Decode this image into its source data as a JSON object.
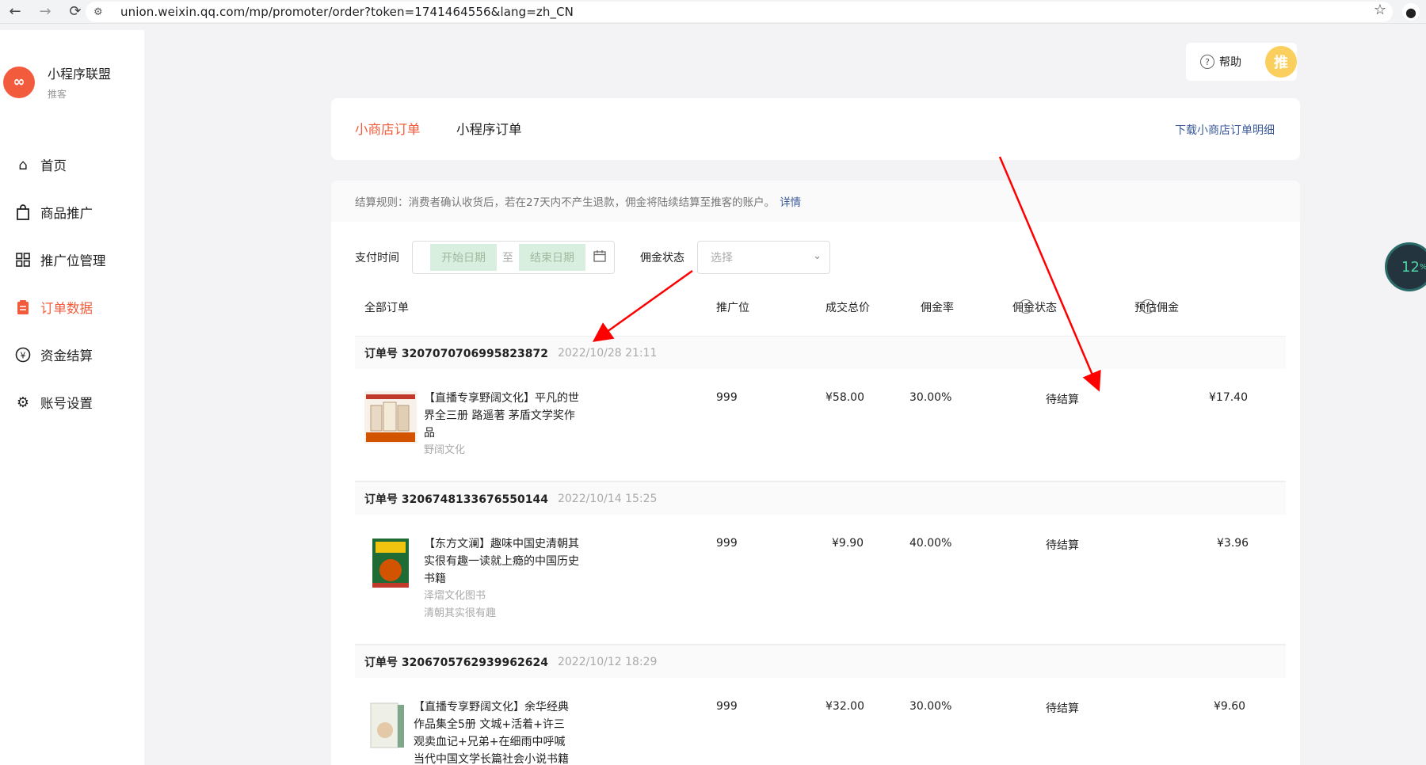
{
  "browser": {
    "url": "union.weixin.qq.com/mp/promoter/order?token=1741464556&lang=zh_CN"
  },
  "sidebar": {
    "brand_name": "小程序联盟",
    "brand_role": "推客",
    "items": [
      {
        "label": "首页",
        "icon": "home-icon"
      },
      {
        "label": "商品推广",
        "icon": "shopping-bag-icon"
      },
      {
        "label": "推广位管理",
        "icon": "grid-icon"
      },
      {
        "label": "订单数据",
        "icon": "clipboard-icon",
        "active": true
      },
      {
        "label": "资金结算",
        "icon": "yuan-coin-icon"
      },
      {
        "label": "账号设置",
        "icon": "gear-icon"
      }
    ]
  },
  "header": {
    "help_label": "帮助",
    "avatar_text": "推"
  },
  "tabs": {
    "shop_orders": "小商店订单",
    "mini_orders": "小程序订单",
    "download": "下载小商店订单明细"
  },
  "rule": {
    "text": "结算规则：消费者确认收货后，若在27天内不产生退款，佣金将陆续结算至推客的账户。",
    "detail": "详情"
  },
  "filters": {
    "pay_time_label": "支付时间",
    "start_placeholder": "开始日期",
    "separator": "至",
    "end_placeholder": "结束日期",
    "commission_status_label": "佣金状态",
    "select_placeholder": "选择"
  },
  "table": {
    "headers": {
      "all_orders": "全部订单",
      "position": "推广位",
      "total": "成交总价",
      "rate": "佣金率",
      "status": "佣金状态",
      "estimate": "预估佣金"
    }
  },
  "orders": [
    {
      "order_no": "订单号 3207070706995823872",
      "time": "2022/10/28 21:11",
      "title": "【直播专享野阔文化】平凡的世界全三册 路遥著 茅盾文学奖作品",
      "subs": [
        "野阔文化"
      ],
      "position": "999",
      "total": "¥58.00",
      "rate": "30.00%",
      "status": "待结算",
      "estimate": "¥17.40"
    },
    {
      "order_no": "订单号 3206748133676550144",
      "time": "2022/10/14 15:25",
      "title": "【东方文澜】趣味中国史清朝其实很有趣一读就上瘾的中国历史书籍",
      "subs": [
        "泽熠文化图书",
        "清朝其实很有趣"
      ],
      "position": "999",
      "total": "¥9.90",
      "rate": "40.00%",
      "status": "待结算",
      "estimate": "¥3.96"
    },
    {
      "order_no": "订单号 3206705762939962624",
      "time": "2022/10/12 18:29",
      "title": "【直播专享野阔文化】余华经典作品集全5册 文城+活着+许三观卖血记+兄弟+在细雨中呼喊当代中国文学长篇社会小说书籍",
      "subs": [],
      "position": "999",
      "total": "¥32.00",
      "rate": "30.00%",
      "status": "待结算",
      "estimate": "¥9.60"
    }
  ],
  "overlay": {
    "progress_percent": 12,
    "progress_label": "12",
    "progress_unit": "%"
  },
  "colors": {
    "accent": "#f25c3c",
    "link": "#3a5a9a",
    "annotation_arrow": "#ff0000"
  }
}
